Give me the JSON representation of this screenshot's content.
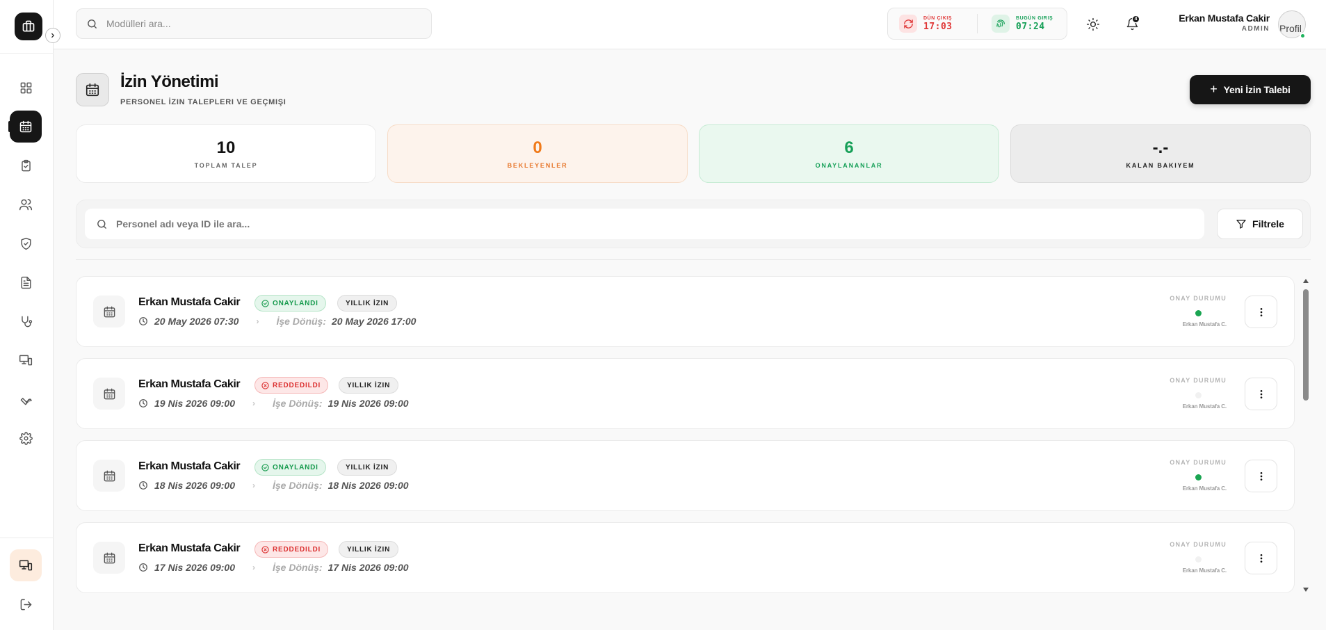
{
  "search": {
    "placeholder": "Modülleri ara..."
  },
  "time_widget": {
    "yesterday_label": "DÜN ÇIKIŞ",
    "yesterday_time": "17:03",
    "today_label": "BUGÜN GIRIŞ",
    "today_time": "07:24"
  },
  "notifications": {
    "count": "4"
  },
  "user": {
    "name": "Erkan Mustafa Cakir",
    "role": "ADMIN",
    "avatar_alt": "Profil"
  },
  "page": {
    "title": "İzin Yönetimi",
    "subtitle": "PERSONEL İZIN TALEPLERI VE GEÇMIŞI",
    "new_button": "Yeni İzin Talebi"
  },
  "stats": [
    {
      "value": "10",
      "label": "TOPLAM TALEP"
    },
    {
      "value": "0",
      "label": "BEKLEYENLER"
    },
    {
      "value": "6",
      "label": "ONAYLANANLAR"
    },
    {
      "value": "-.-",
      "label": "KALAN BAKIYEM"
    }
  ],
  "filter": {
    "placeholder": "Personel adı veya ID ile ara...",
    "button": "Filtrele"
  },
  "requests": [
    {
      "name": "Erkan Mustafa Cakir",
      "status": "ONAYLANDI",
      "type": "YILLIK İZIN",
      "start": "20 May 2026 07:30",
      "return_label": "İşe Dönüş:",
      "return": "20 May 2026 17:00",
      "approval_label": "ONAY DURUMU",
      "approver": "Erkan Mustafa C."
    },
    {
      "name": "Erkan Mustafa Cakir",
      "status": "REDDEDILDI",
      "type": "YILLIK İZIN",
      "start": "19 Nis 2026 09:00",
      "return_label": "İşe Dönüş:",
      "return": "19 Nis 2026 09:00",
      "approval_label": "ONAY DURUMU",
      "approver": "Erkan Mustafa C."
    },
    {
      "name": "Erkan Mustafa Cakir",
      "status": "ONAYLANDI",
      "type": "YILLIK İZIN",
      "start": "18 Nis 2026 09:00",
      "return_label": "İşe Dönüş:",
      "return": "18 Nis 2026 09:00",
      "approval_label": "ONAY DURUMU",
      "approver": "Erkan Mustafa C."
    },
    {
      "name": "Erkan Mustafa Cakir",
      "status": "REDDEDILDI",
      "type": "YILLIK İZIN",
      "start": "17 Nis 2026 09:00",
      "return_label": "İşe Dönüş:",
      "return": "17 Nis 2026 09:00",
      "approval_label": "ONAY DURUMU",
      "approver": "Erkan Mustafa C."
    }
  ],
  "colors": {
    "primary": "#161616",
    "approved": "#159a4c",
    "rejected": "#dc3232",
    "pending": "#f07a1a",
    "approved_stat": "#17a058"
  },
  "icons": {
    "sidebar": [
      "dashboard-icon",
      "calendar-icon",
      "clipboard-check-icon",
      "users-icon",
      "shield-check-icon",
      "document-icon",
      "stethoscope-icon",
      "devices-icon",
      "wrench-icon",
      "gear-icon"
    ],
    "bottom": [
      "devices-icon",
      "logout-icon"
    ]
  }
}
